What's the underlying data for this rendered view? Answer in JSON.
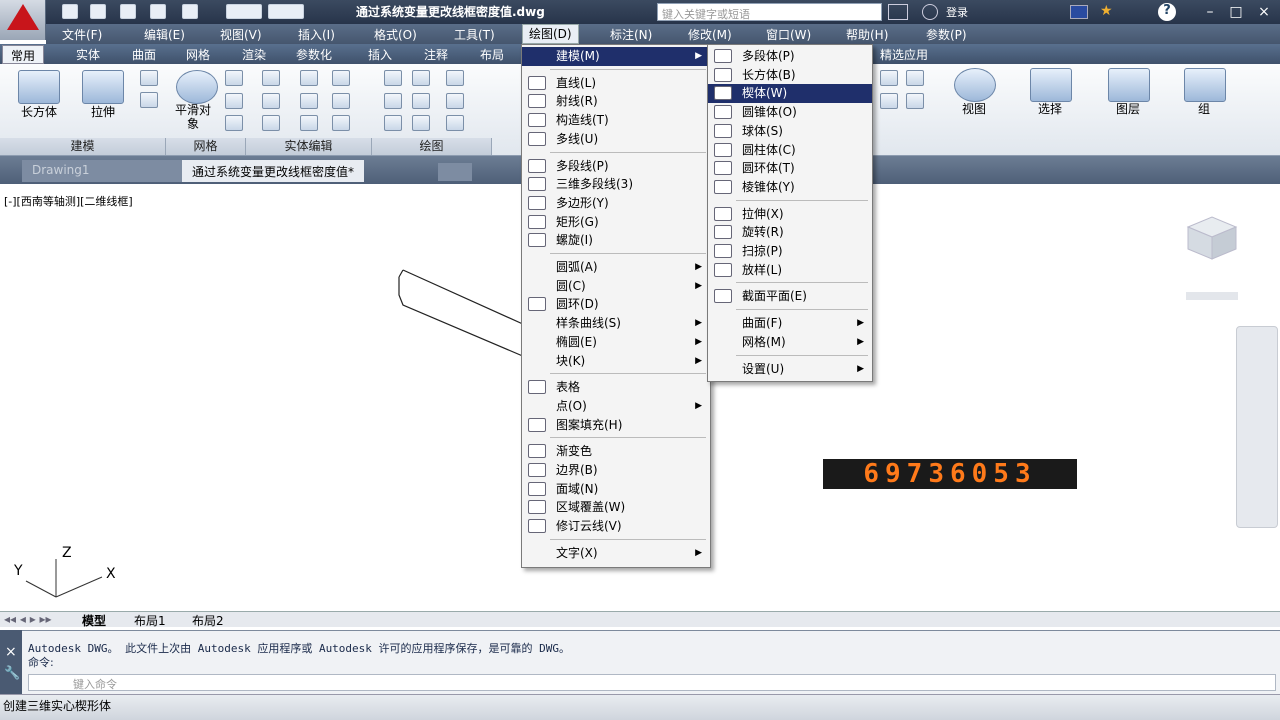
{
  "window": {
    "title": "通过系统变量更改线框密度值.dwg",
    "search_placeholder": "键入关键字或短语",
    "user": "登录",
    "buttons": [
      "–",
      "□",
      "×"
    ]
  },
  "menubar": {
    "items": [
      "文件(F)",
      "编辑(E)",
      "视图(V)",
      "插入(I)",
      "格式(O)",
      "工具(T)",
      "绘图(D)",
      "标注(N)",
      "修改(M)",
      "窗口(W)",
      "帮助(H)",
      "参数(P)"
    ],
    "active": "绘图(D)"
  },
  "ribbon": {
    "tabs": [
      "常用",
      "实体",
      "曲面",
      "网格",
      "渲染",
      "参数化",
      "插入",
      "注释",
      "布局",
      "精选应用"
    ],
    "active_tab": "常用",
    "panels": [
      "建模",
      "网格",
      "实体编辑",
      "绘图"
    ],
    "buttons": {
      "box": "长方体",
      "extrude": "拉伸",
      "smooth": "平滑对象",
      "view": "视图",
      "select": "选择",
      "layers": "图层",
      "group": "组"
    }
  },
  "doc_tabs": [
    "Drawing1",
    "通过系统变量更改线框密度值*"
  ],
  "viewport_label": "[-][西南等轴测][二维线框]",
  "axes": {
    "x": "X",
    "y": "Y",
    "z": "Z"
  },
  "counter": "69736053",
  "layout_tabs": [
    "模型",
    "布局1",
    "布局2"
  ],
  "command": {
    "log": "Autodesk DWG。  此文件上次由 Autodesk 应用程序或 Autodesk 许可的应用程序保存，是可靠的 DWG。",
    "prompt": "命令:",
    "input_placeholder": "键入命令"
  },
  "status": "创建三维实心楔形体",
  "draw_menu": {
    "items": [
      {
        "label": "建模(M)",
        "submenu": true,
        "highlight": true
      },
      {
        "sep": true
      },
      {
        "label": "直线(L)",
        "icon": "line-icon"
      },
      {
        "label": "射线(R)",
        "icon": "ray-icon"
      },
      {
        "label": "构造线(T)",
        "icon": "xline-icon"
      },
      {
        "label": "多线(U)",
        "icon": "mline-icon"
      },
      {
        "sep": true
      },
      {
        "label": "多段线(P)",
        "icon": "pline-icon"
      },
      {
        "label": "三维多段线(3)",
        "icon": "3dpoly-icon"
      },
      {
        "label": "多边形(Y)",
        "icon": "polygon-icon"
      },
      {
        "label": "矩形(G)",
        "icon": "rectangle-icon"
      },
      {
        "label": "螺旋(I)",
        "icon": "helix-icon"
      },
      {
        "sep": true
      },
      {
        "label": "圆弧(A)",
        "submenu": true
      },
      {
        "label": "圆(C)",
        "submenu": true
      },
      {
        "label": "圆环(D)",
        "icon": "donut-icon"
      },
      {
        "label": "样条曲线(S)",
        "submenu": true
      },
      {
        "label": "椭圆(E)",
        "submenu": true
      },
      {
        "label": "块(K)",
        "submenu": true
      },
      {
        "sep": true
      },
      {
        "label": "表格",
        "icon": "table-icon"
      },
      {
        "label": "点(O)",
        "submenu": true
      },
      {
        "label": "图案填充(H)",
        "icon": "hatch-icon"
      },
      {
        "sep": true
      },
      {
        "label": "渐变色",
        "icon": "gradient-icon"
      },
      {
        "label": "边界(B)",
        "icon": "boundary-icon"
      },
      {
        "label": "面域(N)",
        "icon": "region-icon"
      },
      {
        "label": "区域覆盖(W)",
        "icon": "wipeout-icon"
      },
      {
        "label": "修订云线(V)",
        "icon": "revcloud-icon"
      },
      {
        "sep": true
      },
      {
        "label": "文字(X)",
        "submenu": true
      }
    ]
  },
  "modeling_menu": {
    "items": [
      {
        "label": "多段体(P)",
        "icon": "polysolid-icon"
      },
      {
        "label": "长方体(B)",
        "icon": "box-icon"
      },
      {
        "label": "楔体(W)",
        "icon": "wedge-icon",
        "highlight": true
      },
      {
        "label": "圆锥体(O)",
        "icon": "cone-icon"
      },
      {
        "label": "球体(S)",
        "icon": "sphere-icon"
      },
      {
        "label": "圆柱体(C)",
        "icon": "cylinder-icon"
      },
      {
        "label": "圆环体(T)",
        "icon": "torus-icon"
      },
      {
        "label": "棱锥体(Y)",
        "icon": "pyramid-icon"
      },
      {
        "sep": true
      },
      {
        "label": "拉伸(X)",
        "icon": "extrude-icon"
      },
      {
        "label": "旋转(R)",
        "icon": "revolve-icon"
      },
      {
        "label": "扫掠(P)",
        "icon": "sweep-icon"
      },
      {
        "label": "放样(L)",
        "icon": "loft-icon"
      },
      {
        "sep": true
      },
      {
        "label": "截面平面(E)",
        "icon": "section-plane-icon"
      },
      {
        "sep": true
      },
      {
        "label": "曲面(F)",
        "submenu": true
      },
      {
        "label": "网格(M)",
        "submenu": true
      },
      {
        "sep": true
      },
      {
        "label": "设置(U)",
        "submenu": true
      }
    ]
  }
}
